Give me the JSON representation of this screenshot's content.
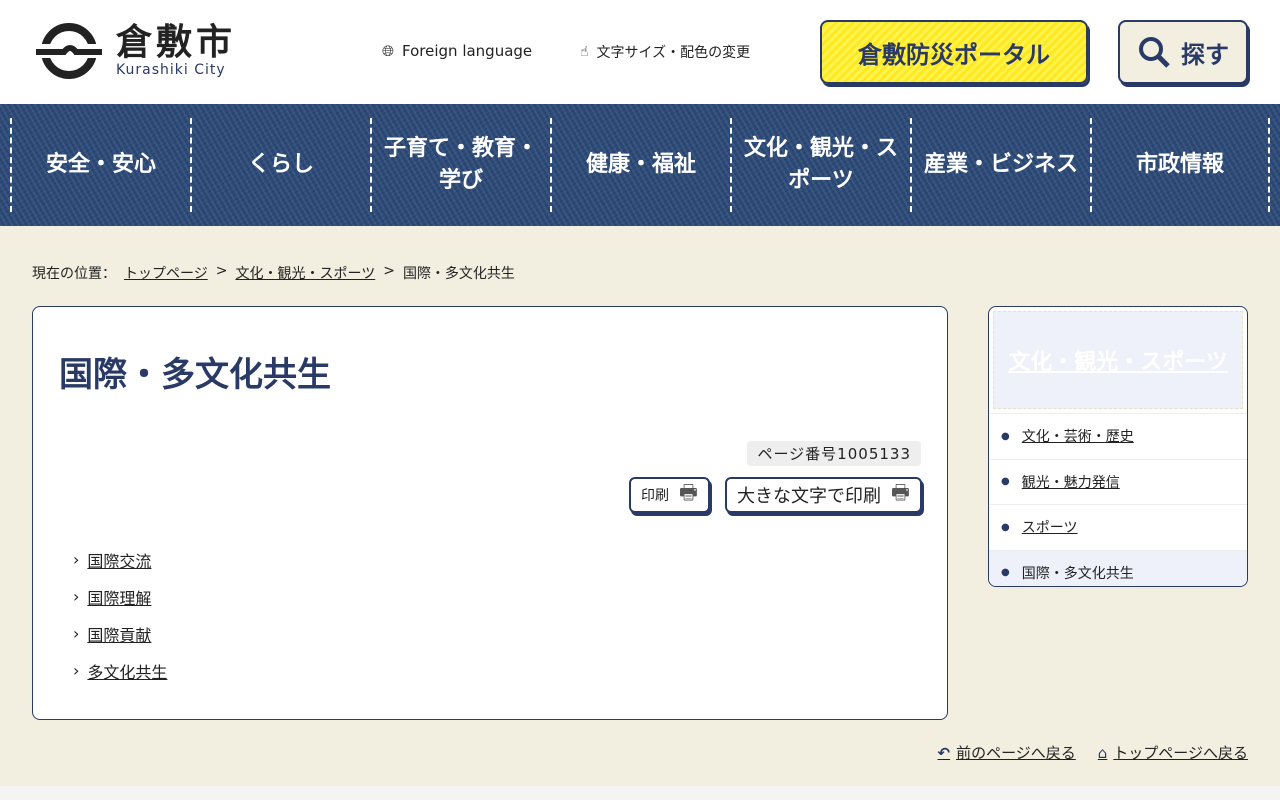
{
  "header": {
    "logo_jp": "倉敷市",
    "logo_en": "Kurashiki City",
    "foreign_language": "Foreign language",
    "font_color": "文字サイズ・配色の変更",
    "bousai": "倉敷防災ポータル",
    "search": "探す"
  },
  "nav": [
    "安全・安心",
    "くらし",
    "子育て・教育・学び",
    "健康・福祉",
    "文化・観光・スポーツ",
    "産業・ビジネス",
    "市政情報"
  ],
  "breadcrumb": {
    "label": "現在の位置：",
    "items": [
      "トップページ",
      "文化・観光・スポーツ"
    ],
    "current": "国際・多文化共生",
    "sep": ">"
  },
  "main": {
    "title": "国際・多文化共生",
    "page_number": "ページ番号1005133",
    "print": "印刷",
    "print_large": "大きな文字で印刷",
    "links": [
      "国際交流",
      "国際理解",
      "国際貢献",
      "多文化共生"
    ]
  },
  "side": {
    "title": "文化・観光・スポーツ",
    "items": [
      "文化・芸術・歴史",
      "観光・魅力発信",
      "スポーツ"
    ],
    "current": "国際・多文化共生"
  },
  "footer": {
    "back": "前のページへ戻る",
    "top": "トップページへ戻る"
  }
}
